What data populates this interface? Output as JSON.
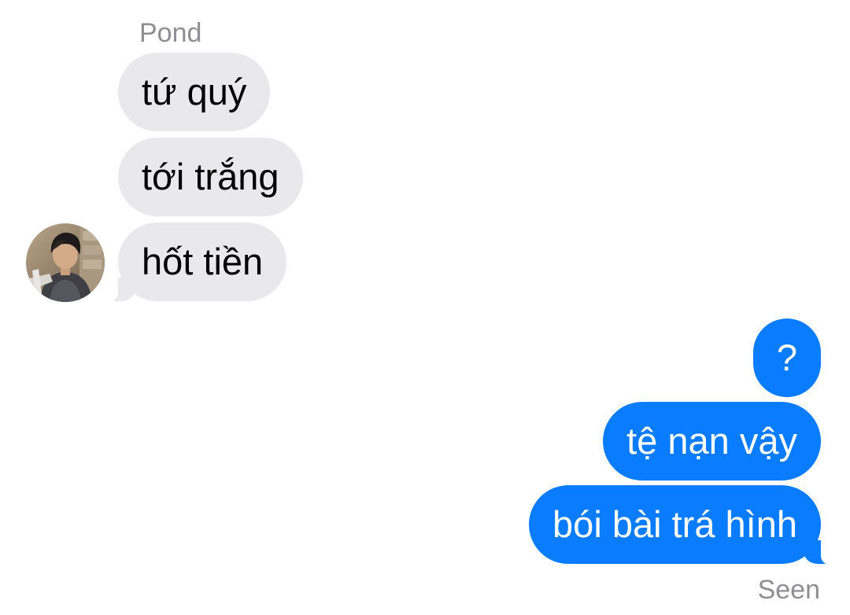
{
  "thread": {
    "sender_name": "Pond",
    "incoming": [
      {
        "text": "tứ quý"
      },
      {
        "text": "tới trắng"
      },
      {
        "text": "hốt tiền"
      }
    ],
    "outgoing": [
      {
        "text": "?"
      },
      {
        "text": "tệ nạn vậy"
      },
      {
        "text": "bói bài trá hình"
      }
    ],
    "read_receipt": "Seen"
  },
  "colors": {
    "incoming_bubble": "#e9e9eb",
    "outgoing_bubble": "#0a7cff",
    "secondary_text": "#8e8e93"
  },
  "icons": {
    "avatar": "contact-photo"
  }
}
